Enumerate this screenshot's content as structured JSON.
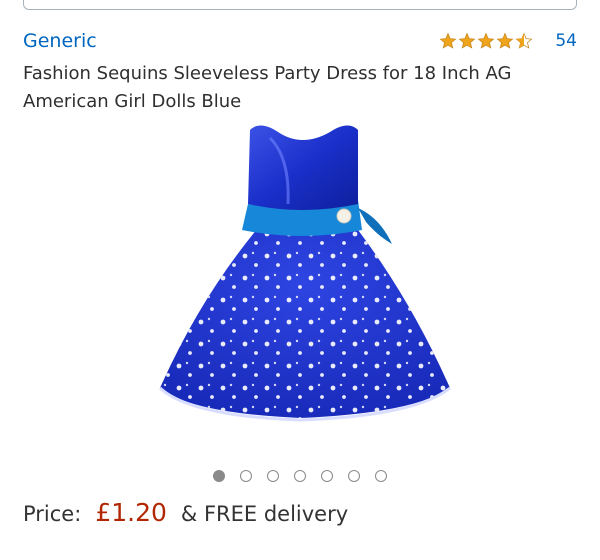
{
  "product": {
    "brand": "Generic",
    "rating": 4.5,
    "rating_count": "54",
    "title": "Fashion Sequins Sleeveless Party Dress for 18 Inch AG American Girl Dolls Blue",
    "image_count": 7,
    "active_image_index": 0
  },
  "price": {
    "label": "Price:",
    "value": "£1.20",
    "delivery": "& FREE delivery"
  },
  "colors": {
    "link": "#0066c0",
    "price": "#b12704",
    "star": "#f0a41c",
    "dress": "#1a2fc9"
  },
  "icons": {
    "rating": "star-icon"
  }
}
